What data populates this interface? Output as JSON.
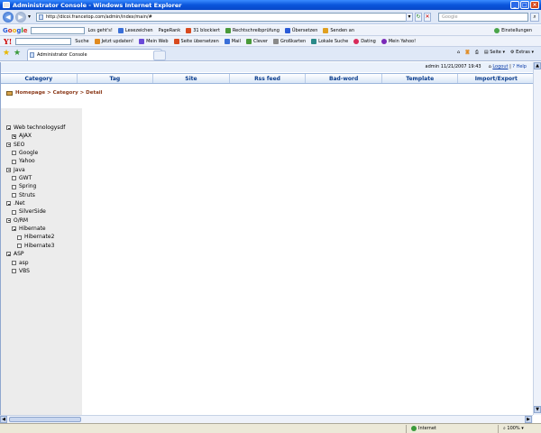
{
  "window": {
    "title": "Administrator Console - Windows Internet Explorer"
  },
  "browser": {
    "url": "http://dicoi.francetop.com/admin/index/main/#",
    "search_placeholder": "Google",
    "google_toolbar": {
      "items": [
        "Los geht's!",
        "Lesezeichen",
        "PageRank",
        "31 blockiert",
        "Rechtschreibprüfung",
        "Übersetzen",
        "Senden an"
      ],
      "settings": "Einstellungen"
    },
    "yahoo_toolbar": {
      "search_label": "Suche",
      "items": [
        "Jetzt updaten!",
        "Mein Web",
        "Seite übersetzen",
        "Mail",
        "Clever",
        "Großkarten",
        "Lokale Suche",
        "Dating",
        "Mein Yahoo!"
      ]
    },
    "tab": {
      "label": "Administrator Console"
    },
    "command_bar": {
      "page": "Seite",
      "extras": "Extras"
    },
    "status": {
      "zone": "Internet",
      "zoom": "100%"
    }
  },
  "header": {
    "user": "admin",
    "datetime": "11/21/2007 19:43",
    "logout": "Logout",
    "separator": "|",
    "help": "? Help"
  },
  "menu": [
    "Category",
    "Tag",
    "Site",
    "Rss feed",
    "Bad-word",
    "Template",
    "Import/Export"
  ],
  "breadcrumb": "Homepage > Category > Detail",
  "tree": [
    {
      "label": "Web technologysdf",
      "level": 1,
      "toggle": "minus"
    },
    {
      "label": "AJAX",
      "level": 2,
      "toggle": "plus"
    },
    {
      "label": "SEO",
      "level": 1,
      "toggle": "minus"
    },
    {
      "label": "Google",
      "level": 2,
      "toggle": "none"
    },
    {
      "label": "Yahoo",
      "level": 2,
      "toggle": "none"
    },
    {
      "label": "Java",
      "level": 1,
      "toggle": "minus"
    },
    {
      "label": "GWT",
      "level": 2,
      "toggle": "none"
    },
    {
      "label": "Spring",
      "level": 2,
      "toggle": "none"
    },
    {
      "label": "Struts",
      "level": 2,
      "toggle": "none"
    },
    {
      "label": ".Net",
      "level": 1,
      "toggle": "minus"
    },
    {
      "label": "SilverSide",
      "level": 2,
      "toggle": "none"
    },
    {
      "label": "O/RM",
      "level": 1,
      "toggle": "minus"
    },
    {
      "label": "Hibernate",
      "level": 2,
      "toggle": "minus"
    },
    {
      "label": "Hibernate2",
      "level": 3,
      "toggle": "none"
    },
    {
      "label": "Hibernate3",
      "level": 3,
      "toggle": "none"
    },
    {
      "label": "ASP",
      "level": 1,
      "toggle": "minus"
    },
    {
      "label": "asp",
      "level": 2,
      "toggle": "none"
    },
    {
      "label": "VBS",
      "level": 2,
      "toggle": "none"
    }
  ]
}
